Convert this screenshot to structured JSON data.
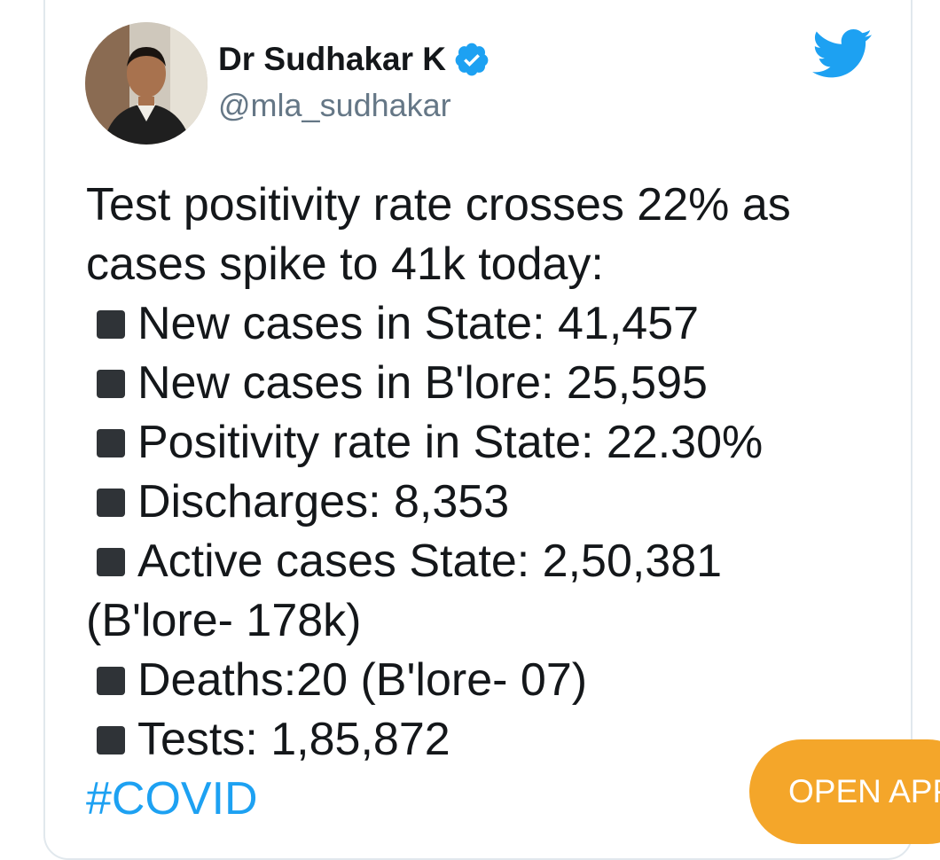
{
  "author": {
    "name": "Dr Sudhakar K",
    "handle": "@mla_sudhakar",
    "verified": true
  },
  "tweet": {
    "intro_line1": "Test positivity rate crosses 22% as",
    "intro_line2": "cases spike to 41k today:",
    "items": [
      "New cases in State: 41,457",
      "New cases in B'lore: 25,595",
      "Positivity rate in State: 22.30%",
      "Discharges: 8,353",
      "Active cases State: 2,50,381"
    ],
    "active_continuation": "(B'lore- 178k)",
    "items_after": [
      "Deaths:20 (B'lore- 07)",
      "Tests: 1,85,872"
    ],
    "hashtag": "#COVID"
  },
  "open_app_button": {
    "label": "OPEN APP"
  },
  "colors": {
    "twitter_blue": "#1da1f2",
    "button_orange": "#f4a62a",
    "text": "#14171a",
    "muted": "#657786"
  },
  "icons": {
    "brand": "twitter-bird-icon",
    "verified": "verified-badge-icon",
    "bullet": "black-square-icon"
  }
}
